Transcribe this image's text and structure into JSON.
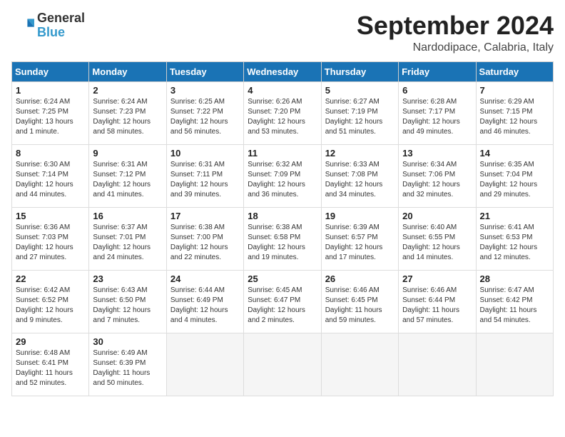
{
  "logo": {
    "general": "General",
    "blue": "Blue"
  },
  "title": {
    "month_year": "September 2024",
    "location": "Nardodipace, Calabria, Italy"
  },
  "days_of_week": [
    "Sunday",
    "Monday",
    "Tuesday",
    "Wednesday",
    "Thursday",
    "Friday",
    "Saturday"
  ],
  "weeks": [
    [
      {
        "day": "1",
        "sunrise": "6:24 AM",
        "sunset": "7:25 PM",
        "daylight": "13 hours and 1 minute."
      },
      {
        "day": "2",
        "sunrise": "6:24 AM",
        "sunset": "7:23 PM",
        "daylight": "12 hours and 58 minutes."
      },
      {
        "day": "3",
        "sunrise": "6:25 AM",
        "sunset": "7:22 PM",
        "daylight": "12 hours and 56 minutes."
      },
      {
        "day": "4",
        "sunrise": "6:26 AM",
        "sunset": "7:20 PM",
        "daylight": "12 hours and 53 minutes."
      },
      {
        "day": "5",
        "sunrise": "6:27 AM",
        "sunset": "7:19 PM",
        "daylight": "12 hours and 51 minutes."
      },
      {
        "day": "6",
        "sunrise": "6:28 AM",
        "sunset": "7:17 PM",
        "daylight": "12 hours and 49 minutes."
      },
      {
        "day": "7",
        "sunrise": "6:29 AM",
        "sunset": "7:15 PM",
        "daylight": "12 hours and 46 minutes."
      }
    ],
    [
      {
        "day": "8",
        "sunrise": "6:30 AM",
        "sunset": "7:14 PM",
        "daylight": "12 hours and 44 minutes."
      },
      {
        "day": "9",
        "sunrise": "6:31 AM",
        "sunset": "7:12 PM",
        "daylight": "12 hours and 41 minutes."
      },
      {
        "day": "10",
        "sunrise": "6:31 AM",
        "sunset": "7:11 PM",
        "daylight": "12 hours and 39 minutes."
      },
      {
        "day": "11",
        "sunrise": "6:32 AM",
        "sunset": "7:09 PM",
        "daylight": "12 hours and 36 minutes."
      },
      {
        "day": "12",
        "sunrise": "6:33 AM",
        "sunset": "7:08 PM",
        "daylight": "12 hours and 34 minutes."
      },
      {
        "day": "13",
        "sunrise": "6:34 AM",
        "sunset": "7:06 PM",
        "daylight": "12 hours and 32 minutes."
      },
      {
        "day": "14",
        "sunrise": "6:35 AM",
        "sunset": "7:04 PM",
        "daylight": "12 hours and 29 minutes."
      }
    ],
    [
      {
        "day": "15",
        "sunrise": "6:36 AM",
        "sunset": "7:03 PM",
        "daylight": "12 hours and 27 minutes."
      },
      {
        "day": "16",
        "sunrise": "6:37 AM",
        "sunset": "7:01 PM",
        "daylight": "12 hours and 24 minutes."
      },
      {
        "day": "17",
        "sunrise": "6:38 AM",
        "sunset": "7:00 PM",
        "daylight": "12 hours and 22 minutes."
      },
      {
        "day": "18",
        "sunrise": "6:38 AM",
        "sunset": "6:58 PM",
        "daylight": "12 hours and 19 minutes."
      },
      {
        "day": "19",
        "sunrise": "6:39 AM",
        "sunset": "6:57 PM",
        "daylight": "12 hours and 17 minutes."
      },
      {
        "day": "20",
        "sunrise": "6:40 AM",
        "sunset": "6:55 PM",
        "daylight": "12 hours and 14 minutes."
      },
      {
        "day": "21",
        "sunrise": "6:41 AM",
        "sunset": "6:53 PM",
        "daylight": "12 hours and 12 minutes."
      }
    ],
    [
      {
        "day": "22",
        "sunrise": "6:42 AM",
        "sunset": "6:52 PM",
        "daylight": "12 hours and 9 minutes."
      },
      {
        "day": "23",
        "sunrise": "6:43 AM",
        "sunset": "6:50 PM",
        "daylight": "12 hours and 7 minutes."
      },
      {
        "day": "24",
        "sunrise": "6:44 AM",
        "sunset": "6:49 PM",
        "daylight": "12 hours and 4 minutes."
      },
      {
        "day": "25",
        "sunrise": "6:45 AM",
        "sunset": "6:47 PM",
        "daylight": "12 hours and 2 minutes."
      },
      {
        "day": "26",
        "sunrise": "6:46 AM",
        "sunset": "6:45 PM",
        "daylight": "11 hours and 59 minutes."
      },
      {
        "day": "27",
        "sunrise": "6:46 AM",
        "sunset": "6:44 PM",
        "daylight": "11 hours and 57 minutes."
      },
      {
        "day": "28",
        "sunrise": "6:47 AM",
        "sunset": "6:42 PM",
        "daylight": "11 hours and 54 minutes."
      }
    ],
    [
      {
        "day": "29",
        "sunrise": "6:48 AM",
        "sunset": "6:41 PM",
        "daylight": "11 hours and 52 minutes."
      },
      {
        "day": "30",
        "sunrise": "6:49 AM",
        "sunset": "6:39 PM",
        "daylight": "11 hours and 50 minutes."
      },
      null,
      null,
      null,
      null,
      null
    ]
  ]
}
